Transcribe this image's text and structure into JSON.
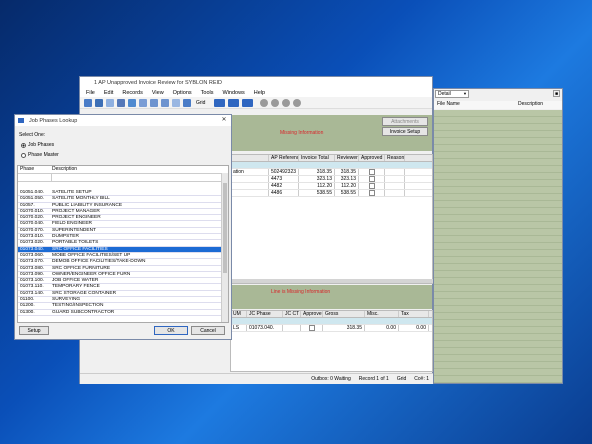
{
  "main_window": {
    "title": "1 AP Unapproved Invoice Review for SYBLON REID",
    "menu": [
      "File",
      "Edit",
      "Records",
      "View",
      "Options",
      "Tools",
      "Windows",
      "Help"
    ],
    "toolbar_grid_label": "Grid",
    "attachments_label": "Attachments",
    "invoice_setup_label": "Invoice Setup",
    "missing_info": "Missing Information",
    "line_missing_info": "Line is Missing Information",
    "top_grid": {
      "columns": [
        "AP Reference",
        "Invoice Total",
        "Reviewer Total",
        "Approved",
        "Reason"
      ],
      "rows": [
        {
          "desc": "ation",
          "ref": "502492323",
          "inv": "318.35",
          "rev": "318.35"
        },
        {
          "desc": "",
          "ref": "4473",
          "inv": "323.13",
          "rev": "323.13"
        },
        {
          "desc": "",
          "ref": "4482",
          "inv": "112.20",
          "rev": "112.20"
        },
        {
          "desc": "",
          "ref": "4486",
          "inv": "538.55",
          "rev": "538.55"
        }
      ]
    },
    "bottom_grid": {
      "columns": [
        "UM",
        "JC Phase",
        "JC CT",
        "Approve",
        "Gross",
        "Misc.",
        "Tax"
      ],
      "row": {
        "um": "LS",
        "phase": "01073.040.",
        "gross": "318.35",
        "misc": "0.00",
        "tax": "0.00"
      }
    },
    "status": {
      "outbox": "Outbox: 0 Waiting",
      "record": "Record 1 of 1",
      "grid": "Grid",
      "co": "Co#: 1"
    }
  },
  "detail_panel": {
    "dropdown": "Detail",
    "col_file": "File Name",
    "col_desc": "Description"
  },
  "lookup": {
    "title": "Job Phases Lookup",
    "select_one": "Select One:",
    "option1": "Job Phases",
    "option2": "Phase Master",
    "col_phase": "Phase",
    "col_desc": "Description",
    "rows": [
      {
        "phase": "01051.040.",
        "desc": "SATELITE SETUP"
      },
      {
        "phase": "01051.050.",
        "desc": "SATELITE MONTHLY BILL"
      },
      {
        "phase": "01057.",
        "desc": "PUBLIC LIABILITY INSURANCE"
      },
      {
        "phase": "01070.010.",
        "desc": "PROJECT MANAGER"
      },
      {
        "phase": "01070.020.",
        "desc": "PROJECT ENGINEER"
      },
      {
        "phase": "01070.040.",
        "desc": "FIELD ENGINEER"
      },
      {
        "phase": "01070.070.",
        "desc": "SUPERINTENDENT"
      },
      {
        "phase": "01073.010.",
        "desc": "DUMPSTER"
      },
      {
        "phase": "01073.020.",
        "desc": "PORTABLE TOILETS"
      },
      {
        "phase": "01073.040.",
        "desc": "SRC OFFICE FACILITIES"
      },
      {
        "phase": "01073.060.",
        "desc": "MOBE OFFICE FACILITIES/SET UP"
      },
      {
        "phase": "01073.070.",
        "desc": "DEMOB OFFICE FACILITIES/TAKE-DOWN"
      },
      {
        "phase": "01073.080.",
        "desc": "SRC OFFICE FURNITURE"
      },
      {
        "phase": "01073.090.",
        "desc": "OWNER/ENGINEER OFFICE FURN"
      },
      {
        "phase": "01073.100.",
        "desc": "JOB OFFICE WATER"
      },
      {
        "phase": "01073.110.",
        "desc": "TEMPORARY FENCE"
      },
      {
        "phase": "01073.140.",
        "desc": "SRC STORAGE CONTAINER"
      },
      {
        "phase": "01100.",
        "desc": "SURVEYING"
      },
      {
        "phase": "01200.",
        "desc": "TESTING/INSPECTION"
      },
      {
        "phase": "01300.",
        "desc": "GUARD SUBCONTRACTOR"
      }
    ],
    "selected_index": 9,
    "setup_label": "Setup",
    "ok_label": "OK",
    "cancel_label": "Cancel"
  }
}
